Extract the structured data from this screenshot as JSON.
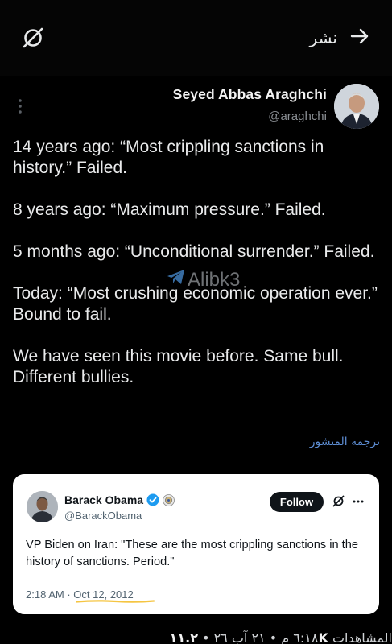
{
  "topbar": {
    "share_label": "نشر",
    "left_icon": "x-logo-slashed-icon",
    "right_icon": "arrow-right-icon"
  },
  "tweet": {
    "author_name": "Seyed Abbas Araghchi",
    "author_handle": "@araghchi",
    "paragraphs": [
      "14 years ago: “Most crippling sanctions in history.” Failed.",
      "8 years ago: “Maximum pressure.” Failed.",
      "5 months ago: “Unconditional surrender.” Failed.",
      "Today: “Most crushing economic operation ever.” Bound to fail.",
      "We have seen this movie before. Same bull. Different bullies."
    ],
    "translate_label": "ترجمة المنشور"
  },
  "watermark": {
    "text": "Alibk3"
  },
  "quote": {
    "name": "Barack Obama",
    "handle": "@BarackObama",
    "follow_label": "Follow",
    "text": "VP Biden on Iran: \"These are the most crippling sanctions in the history of sanctions. Period.\"",
    "time": "2:18 AM",
    "separator": "·",
    "date": "Oct 12, 2012"
  },
  "bottom": {
    "time_date": "٦:١٨ م ‏• ٢١ آب ٢٦ •",
    "views_count": "١١.٢K",
    "views_label": "المشاهدات"
  },
  "colors": {
    "background": "#000000",
    "link": "#5e8ed4",
    "verified": "#1d9bf0",
    "underline": "#f5c542"
  }
}
